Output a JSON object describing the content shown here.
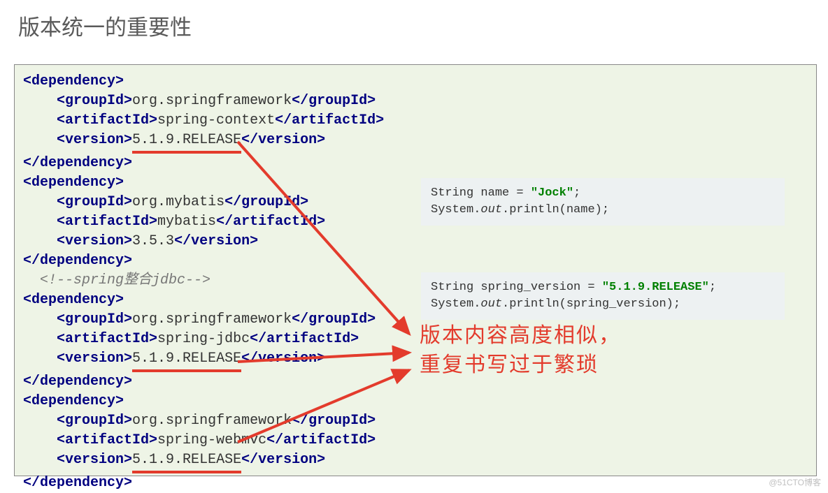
{
  "title": "版本统一的重要性",
  "xml": {
    "deps": [
      {
        "groupId": "org.springframework",
        "artifactId": "spring-context",
        "version": "5.1.9.RELEASE",
        "underline": true
      },
      {
        "groupId": "org.mybatis",
        "artifactId": "mybatis",
        "version": "3.5.3",
        "underline": false
      },
      {
        "groupId": "org.springframework",
        "artifactId": "spring-jdbc",
        "version": "5.1.9.RELEASE",
        "underline": true
      },
      {
        "groupId": "org.springframework",
        "artifactId": "spring-webmvc",
        "version": "5.1.9.RELEASE",
        "underline": true
      }
    ],
    "comment": "<!--spring整合jdbc-->",
    "tag": {
      "dependency_open": "<dependency>",
      "dependency_close": "</dependency>",
      "groupId_open": "<groupId>",
      "groupId_close": "</groupId>",
      "artifactId_open": "<artifactId>",
      "artifactId_close": "</artifactId>",
      "version_open": "<version>",
      "version_close": "</version>"
    }
  },
  "java_top": {
    "line1_pre": "String name = ",
    "line1_str": "\"Jock\"",
    "line1_post": ";",
    "line2_pre": "System.",
    "line2_it": "out",
    "line2_post": ".println(name);"
  },
  "java_bot": {
    "line1_pre": "String spring_version = ",
    "line1_str": "\"5.1.9.RELEASE\"",
    "line1_post": ";",
    "line2_pre": "System.",
    "line2_it": "out",
    "line2_post": ".println(spring_version);"
  },
  "annotation": {
    "line1": "版本内容高度相似，",
    "line2": "重复书写过于繁琐"
  },
  "watermark": "@51CTO博客"
}
